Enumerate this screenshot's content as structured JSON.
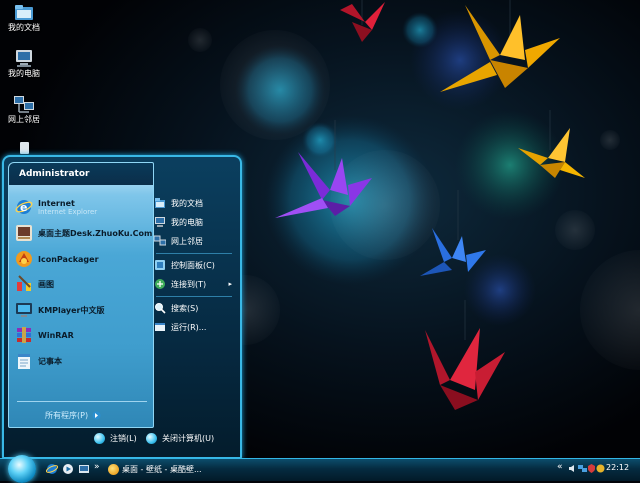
{
  "desktop": {
    "icons": [
      {
        "label": "我的文档",
        "icon": "my-documents-icon"
      },
      {
        "label": "我的电脑",
        "icon": "my-computer-icon"
      },
      {
        "label": "网上邻居",
        "icon": "network-places-icon"
      }
    ]
  },
  "start_menu": {
    "username": "Administrator",
    "programs": [
      {
        "label": "Internet",
        "sublabel": "Internet Explorer",
        "icon": "internet-explorer-icon"
      },
      {
        "label": "桌面主题Desk.ZhuoKu.Com",
        "icon": "desk-zhuoku-icon"
      },
      {
        "label": "IconPackager",
        "icon": "iconpackager-icon"
      },
      {
        "label": "画图",
        "icon": "paint-icon"
      },
      {
        "label": "KMPlayer中文版",
        "icon": "kmplayer-icon"
      },
      {
        "label": "WinRAR",
        "icon": "winrar-icon"
      },
      {
        "label": "记事本",
        "icon": "notepad-icon"
      }
    ],
    "all_programs_label": "所有程序(P)",
    "places": [
      {
        "label": "我的文档",
        "icon": "my-documents-icon"
      },
      {
        "label": "我的电脑",
        "icon": "my-computer-icon"
      },
      {
        "label": "网上邻居",
        "icon": "network-places-icon"
      },
      {
        "label": "控制面板(C)",
        "icon": "control-panel-icon"
      },
      {
        "label": "连接到(T)",
        "icon": "connect-to-icon",
        "submenu_arrow": "▸"
      },
      {
        "label": "搜索(S)",
        "icon": "search-icon"
      },
      {
        "label": "运行(R)...",
        "icon": "run-icon"
      }
    ],
    "logoff_label": "注销(L)",
    "shutdown_label": "关闭计算机(U)"
  },
  "taskbar": {
    "quick_launch": [
      "internet-explorer-icon",
      "media-player-icon",
      "show-desktop-icon"
    ],
    "chevron": "»",
    "tasks": [
      {
        "label": "桌面 - 壁纸 - 桌酷壁...",
        "icon": "browser-icon"
      }
    ],
    "tray_chevron": "«",
    "tray_icons": [
      "volume-icon",
      "network-icon",
      "security-icon",
      "update-icon",
      "printer-icon"
    ],
    "clock": "22:12"
  },
  "colors": {
    "accent": "#39b8e6",
    "start_panel": "#0b3f5f",
    "program_area": "#4aa7d6",
    "taskbar": "#052b40"
  }
}
